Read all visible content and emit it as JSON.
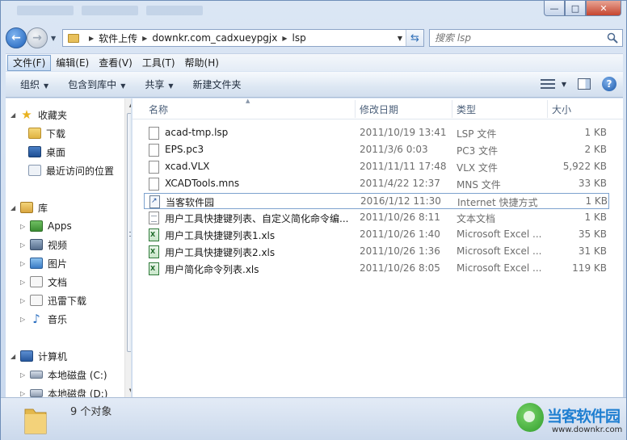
{
  "window": {
    "min_icon": "minimize-icon",
    "max_icon": "maximize-icon",
    "close_icon": "close-icon"
  },
  "address": {
    "crumbs": [
      "软件上传",
      "downkr.com_cadxueypgjx",
      "lsp"
    ]
  },
  "search": {
    "placeholder": "搜索 lsp"
  },
  "menu": [
    "文件(F)",
    "编辑(E)",
    "查看(V)",
    "工具(T)",
    "帮助(H)"
  ],
  "toolbar": {
    "organize": "组织",
    "include_library": "包含到库中",
    "share": "共享",
    "new_folder": "新建文件夹"
  },
  "navpane": {
    "favorites": "收藏夹",
    "favorites_items": [
      "下载",
      "桌面",
      "最近访问的位置"
    ],
    "libraries": "库",
    "library_items": [
      "Apps",
      "视频",
      "图片",
      "文档",
      "迅雷下载",
      "音乐"
    ],
    "computer": "计算机",
    "drives": [
      "本地磁盘 (C:)",
      "本地磁盘 (D:)"
    ]
  },
  "columns": {
    "name": "名称",
    "date": "修改日期",
    "type": "类型",
    "size": "大小"
  },
  "files": [
    {
      "name": "acad-tmp.lsp",
      "date": "2011/10/19 13:41",
      "type": "LSP 文件",
      "size": "1 KB",
      "icon": "file-icon"
    },
    {
      "name": "EPS.pc3",
      "date": "2011/3/6 0:03",
      "type": "PC3 文件",
      "size": "2 KB",
      "icon": "file-icon"
    },
    {
      "name": "xcad.VLX",
      "date": "2011/11/11 17:48",
      "type": "VLX 文件",
      "size": "5,922 KB",
      "icon": "file-icon"
    },
    {
      "name": "XCADTools.mns",
      "date": "2011/4/22 12:37",
      "type": "MNS 文件",
      "size": "33 KB",
      "icon": "file-icon"
    },
    {
      "name": "当客软件园",
      "date": "2016/1/12 11:30",
      "type": "Internet 快捷方式",
      "size": "1 KB",
      "icon": "shortcut-icon"
    },
    {
      "name": "用户工具快捷键列表、自定义简化命令编...",
      "date": "2011/10/26 8:11",
      "type": "文本文档",
      "size": "1 KB",
      "icon": "text-file-icon"
    },
    {
      "name": "用户工具快捷键列表1.xls",
      "date": "2011/10/26 1:40",
      "type": "Microsoft Excel ...",
      "size": "35 KB",
      "icon": "excel-icon"
    },
    {
      "name": "用户工具快捷键列表2.xls",
      "date": "2011/10/26 1:36",
      "type": "Microsoft Excel ...",
      "size": "31 KB",
      "icon": "excel-icon"
    },
    {
      "name": "用户简化命令列表.xls",
      "date": "2011/10/26 8:05",
      "type": "Microsoft Excel ...",
      "size": "119 KB",
      "icon": "excel-icon"
    }
  ],
  "status": {
    "count": "9 个对象"
  },
  "watermark": {
    "name": "当客软件园",
    "url": "www.downkr.com"
  }
}
